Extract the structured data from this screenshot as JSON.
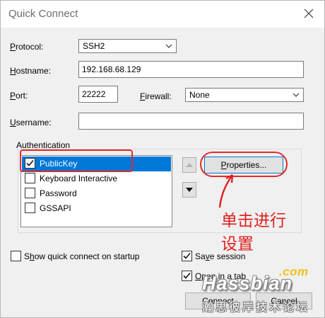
{
  "window": {
    "title": "Quick Connect"
  },
  "form": {
    "protocol_label": "Protocol:",
    "protocol_value": "SSH2",
    "hostname_label": "Hostname:",
    "hostname_value": "192.168.68.129",
    "port_label": "Port:",
    "port_value": "22222",
    "firewall_label": "Firewall:",
    "firewall_value": "None",
    "username_label": "Username:",
    "username_value": ""
  },
  "auth": {
    "group_label": "Authentication",
    "items": [
      {
        "label": "PublicKey",
        "checked": true,
        "selected": true
      },
      {
        "label": "Keyboard Interactive",
        "checked": false
      },
      {
        "label": "Password",
        "checked": false
      },
      {
        "label": "GSSAPI",
        "checked": false
      }
    ],
    "properties_label": "Properties..."
  },
  "options": {
    "show_on_startup_label": "Show quick connect on startup",
    "show_on_startup_checked": false,
    "save_session_label": "Save session",
    "save_session_checked": true,
    "open_in_tab_label": "Open in a tab",
    "open_in_tab_checked": true
  },
  "buttons": {
    "connect_label": "Connect",
    "cancel_label": "Cancel"
  },
  "annotation": {
    "line1": "单击进行",
    "line2": "设置",
    "color": "#e02020"
  },
  "watermark": {
    "domain": ".com",
    "brand": "Hassbian",
    "subtitle": "瀚思彼岸技术论坛"
  }
}
